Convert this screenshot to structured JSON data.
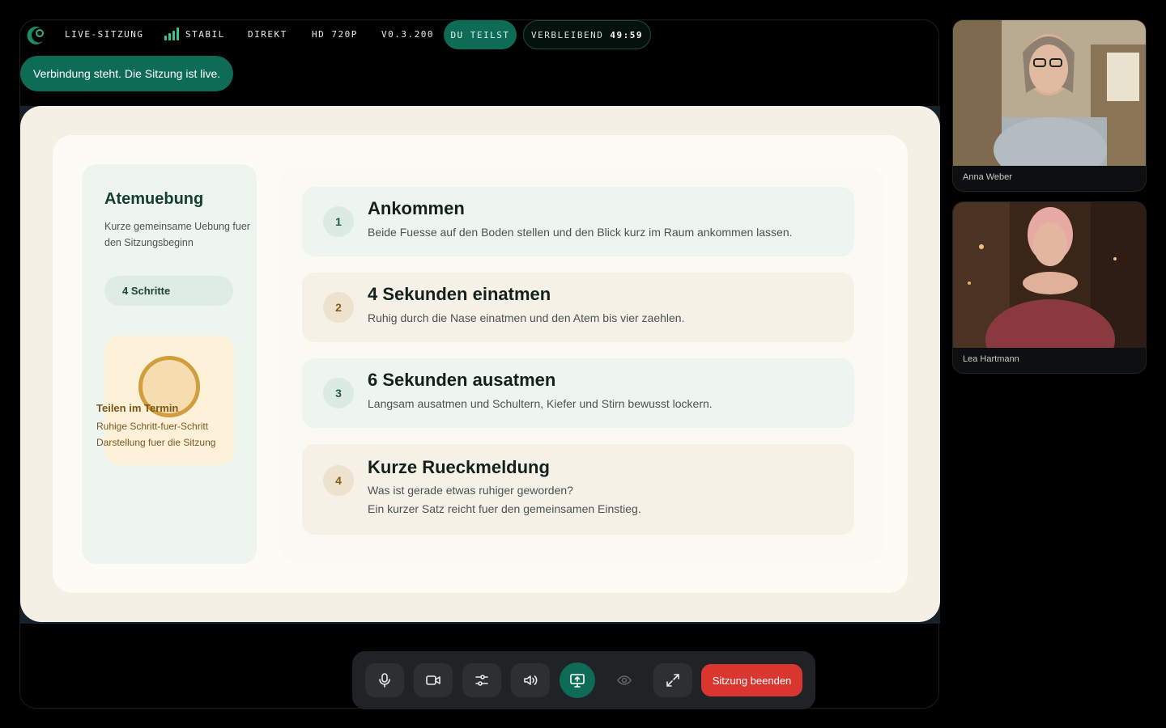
{
  "statusbar": {
    "session": "LIVE-SITZUNG",
    "signal": "STABIL",
    "mode": "DIREKT",
    "quality": "HD 720P",
    "version": "V0.3.200",
    "sharing": "DU TEILST",
    "remaining_label": "VERBLEIBEND",
    "remaining_time": "49:59"
  },
  "toast": "Verbindung steht. Die Sitzung ist live.",
  "slide": {
    "title": "Atemuebung",
    "subtitle": "Kurze gemeinsame Uebung fuer den Sitzungsbeginn",
    "steps_badge": "4 Schritte",
    "card_title": "Teilen im Termin",
    "card_text": "Ruhige Schritt-fuer-Schritt Darstellung fuer die Sitzung",
    "steps": [
      {
        "num": "1",
        "title": "Ankommen",
        "text": "Beide Fuesse auf den Boden stellen und den Blick kurz im Raum ankommen lassen.",
        "text2": ""
      },
      {
        "num": "2",
        "title": "4 Sekunden einatmen",
        "text": "Ruhig durch die Nase einatmen und den Atem bis vier zaehlen.",
        "text2": ""
      },
      {
        "num": "3",
        "title": "6 Sekunden ausatmen",
        "text": "Langsam ausatmen und Schultern, Kiefer und Stirn bewusst lockern.",
        "text2": ""
      },
      {
        "num": "4",
        "title": "Kurze Rueckmeldung",
        "text": "Was ist gerade etwas ruhiger geworden?",
        "text2": "Ein kurzer Satz reicht fuer den gemeinsamen Einstieg."
      }
    ]
  },
  "controls": {
    "end_label": "Sitzung beenden",
    "icons": [
      "microphone-icon",
      "camera-icon",
      "settings-sliders-icon",
      "speaker-icon",
      "screen-share-icon",
      "eye-icon",
      "fullscreen-icon"
    ]
  },
  "participants": [
    {
      "name": "Anna Weber"
    },
    {
      "name": "Lea Hartmann"
    }
  ],
  "colors": {
    "accent": "#0e6b56",
    "danger": "#d9362f",
    "signal": "#3cc48a"
  }
}
